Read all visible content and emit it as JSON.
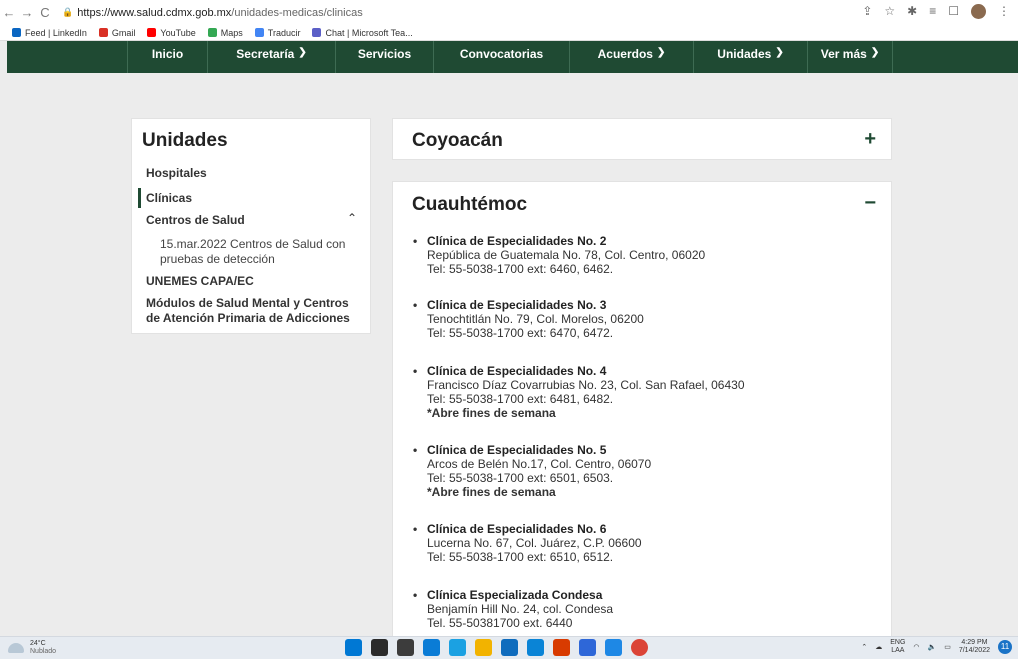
{
  "browser": {
    "url_host": "https://www.salud.cdmx.gob.mx",
    "url_path": "/unidades-medicas/clinicas",
    "bookmarks": [
      "Feed | LinkedIn",
      "Gmail",
      "YouTube",
      "Maps",
      "Traducir",
      "Chat | Microsoft Tea..."
    ],
    "bookmark_colors": [
      "#0a66c2",
      "#d93025",
      "#ff0000",
      "#34a853",
      "#4285f4",
      "#5b5fc7"
    ]
  },
  "nav": [
    {
      "label": "Inicio",
      "chevron": false
    },
    {
      "label": "Secretaría",
      "chevron": true
    },
    {
      "label": "Servicios",
      "chevron": false
    },
    {
      "label": "Convocatorias",
      "chevron": false
    },
    {
      "label": "Acuerdos",
      "chevron": true
    },
    {
      "label": "Unidades",
      "chevron": true
    },
    {
      "label": "Ver más",
      "chevron": true
    }
  ],
  "sidebar": {
    "title": "Unidades",
    "items": [
      {
        "label": "Hospitales"
      },
      {
        "label": "Clínicas",
        "active": true
      },
      {
        "label": "Centros de Salud",
        "expanded": true
      }
    ],
    "sub_item": "15.mar.2022 Centros de Salud con pruebas de detección",
    "item_unemes": "UNEMES CAPA/EC",
    "item_modulos": "Módulos de Salud Mental y Centros de Atención Primaria de Adicciones"
  },
  "accordion": {
    "collapsed_title": "Coyoacán",
    "collapsed_toggle": "+",
    "expanded_title": "Cuauhtémoc",
    "expanded_toggle": "−",
    "clinics": [
      {
        "name": "Clínica de Especialidades No. 2",
        "address": "República de Guatemala No. 78, Col. Centro,  06020",
        "tel": "Tel: 55-5038-1700 ext: 6460, 6462.",
        "note": ""
      },
      {
        "name": "Clínica de Especialidades No. 3",
        "address": "Tenochtitlán No. 79, Col. Morelos, 06200",
        "tel": "Tel: 55-5038-1700 ext: 6470, 6472.",
        "note": ""
      },
      {
        "name": "Clínica de Especialidades No. 4",
        "address": "Francisco Díaz Covarrubias No. 23, Col. San Rafael,  06430",
        "tel": "Tel: 55-5038-1700 ext: 6481, 6482.",
        "note": "*Abre fines de semana"
      },
      {
        "name": "Clínica de Especialidades No. 5",
        "address": "Arcos de Belén No.17, Col. Centro,  06070",
        "tel": "Tel: 55-5038-1700 ext: 6501, 6503.",
        "note": "*Abre fines de semana"
      },
      {
        "name": "Clínica de Especialidades No. 6",
        "address": "Lucerna No. 67, Col. Juárez, C.P. 06600",
        "tel": "Tel: 55-5038-1700 ext: 6510, 6512.",
        "note": ""
      },
      {
        "name": "Clínica Especializada Condesa",
        "address": "Benjamín Hill No. 24, col. Condesa",
        "tel": "Tel. 55-50381700 ext. 6440",
        "note": ""
      }
    ]
  },
  "taskbar": {
    "temp": "24°C",
    "weather": "Nublado",
    "lang_1": "ENG",
    "lang_2": "LAA",
    "time": "4:29 PM",
    "date": "7/14/2022",
    "notifications": "11",
    "app_colors": [
      "#0078d4",
      "#2b2b2b",
      "#3c3c3c",
      "#0a7cd6",
      "#1ba1e2",
      "#f2b300",
      "#0f6cbd",
      "#0a84d6",
      "#d83b01",
      "#2e67d8",
      "#1e88e5",
      "#db4437"
    ]
  },
  "colors": {
    "brand_green": "#1f4a33",
    "page_bg": "#ececec"
  }
}
